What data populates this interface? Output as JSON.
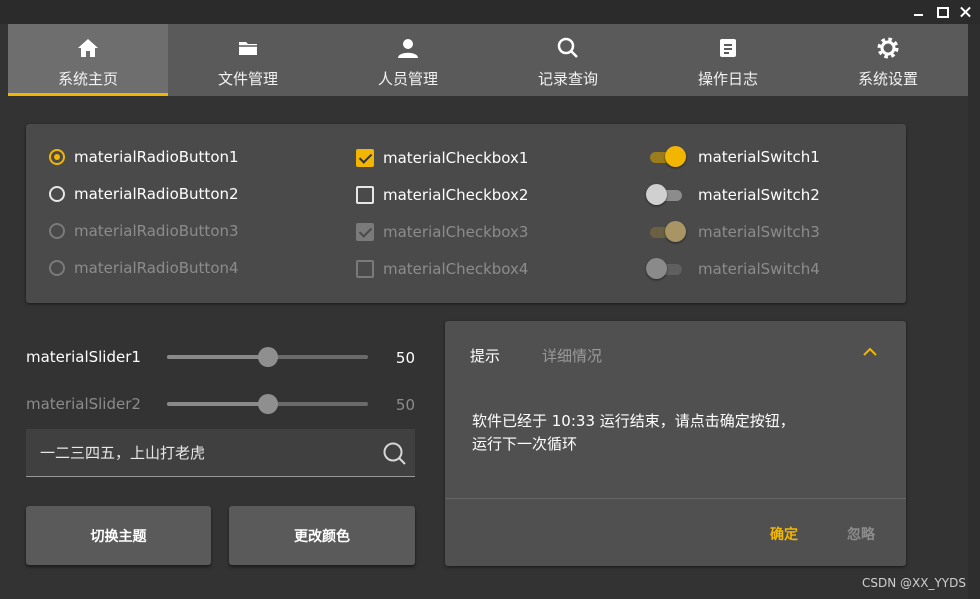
{
  "tabs": [
    {
      "label": "系统主页",
      "icon": "home-icon",
      "active": true
    },
    {
      "label": "文件管理",
      "icon": "folder-icon",
      "active": false
    },
    {
      "label": "人员管理",
      "icon": "person-icon",
      "active": false
    },
    {
      "label": "记录查询",
      "icon": "search-icon",
      "active": false
    },
    {
      "label": "操作日志",
      "icon": "log-icon",
      "active": false
    },
    {
      "label": "系统设置",
      "icon": "gear-icon",
      "active": false
    }
  ],
  "controls": {
    "radios": [
      {
        "label": "materialRadioButton1",
        "checked": true,
        "enabled": true
      },
      {
        "label": "materialRadioButton2",
        "checked": false,
        "enabled": true
      },
      {
        "label": "materialRadioButton3",
        "checked": false,
        "enabled": false
      },
      {
        "label": "materialRadioButton4",
        "checked": false,
        "enabled": false
      }
    ],
    "checkboxes": [
      {
        "label": "materialCheckbox1",
        "checked": true,
        "enabled": true
      },
      {
        "label": "materialCheckbox2",
        "checked": false,
        "enabled": true
      },
      {
        "label": "materialCheckbox3",
        "checked": true,
        "enabled": false
      },
      {
        "label": "materialCheckbox4",
        "checked": false,
        "enabled": false
      }
    ],
    "switches": [
      {
        "label": "materialSwitch1",
        "on": true,
        "enabled": true
      },
      {
        "label": "materialSwitch2",
        "on": false,
        "enabled": true
      },
      {
        "label": "materialSwitch3",
        "on": true,
        "enabled": false
      },
      {
        "label": "materialSwitch4",
        "on": false,
        "enabled": false
      }
    ]
  },
  "sliders": [
    {
      "label": "materialSlider1",
      "value": "50",
      "fraction": 0.5,
      "enabled": true
    },
    {
      "label": "materialSlider2",
      "value": "50",
      "fraction": 0.5,
      "enabled": false
    }
  ],
  "textbox": {
    "value": "一二三四五，上山打老虎",
    "icon": "search-icon"
  },
  "buttons": {
    "switch_theme": "切换主题",
    "change_color": "更改颜色"
  },
  "dialog": {
    "tab_tip": "提示",
    "tab_detail": "详细情况",
    "message_line1": "软件已经于 10:33 运行结束，请点击确定按钮，",
    "message_line2": "运行下一次循环",
    "ok": "确定",
    "ignore": "忽略"
  },
  "footer": {
    "text": "CSDN @XX_YYDS"
  },
  "colors": {
    "accent": "#f2b600",
    "background": "#333333",
    "card": "#4a4a4a"
  }
}
